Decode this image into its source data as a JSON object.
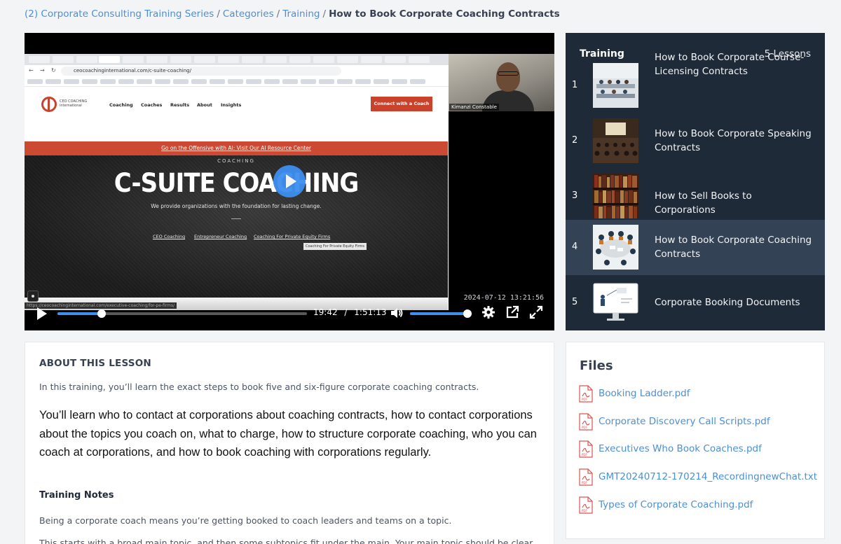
{
  "breadcrumb": {
    "items": [
      "(2) Corporate Consulting Training Series",
      "Categories",
      "Training"
    ],
    "current": "How to Book Corporate Coaching Contracts"
  },
  "video": {
    "browser_url": "ceocoachinginternational.com/c-suite-coaching/",
    "site_logo_text": "CEO COACHING international",
    "site_nav": [
      "Coaching",
      "Coaches",
      "Results",
      "About",
      "Insights"
    ],
    "connect_button": "Connect with a Coach",
    "promo_banner": "Go on the Offensive with AI: Visit Our AI Resource Center",
    "hero_eyebrow": "COACHING",
    "hero_headline": "C-SUITE COACHING",
    "hero_sub": "We provide organizations with the foundation for lasting change.",
    "hero_links": [
      "CEO Coaching",
      "Entrepreneur Coaching",
      "Coaching For Private Equity Firms"
    ],
    "hero_tooltip": "Coaching For Private Equity Firms",
    "webcam_name": "Kimanzi Constable",
    "recording_timestamp": "2024-07-12  13:21:56",
    "status_url": "https://ceocoachinginternational.com/executive-coaching/for-pe-firms/",
    "current_time": "19:42",
    "time_separator": "/",
    "duration": "1:51:13",
    "progress_fraction": 0.177,
    "volume_fraction": 1.0,
    "accent_color": "#3d8ff0"
  },
  "playlist": {
    "title": "Training",
    "count": "5 Lessons",
    "lessons": [
      {
        "num": "1",
        "name": "How to Book Corporate Course-Licensing Contracts",
        "thumb": "classroom"
      },
      {
        "num": "2",
        "name": "How to Book Corporate Speaking Contracts",
        "thumb": "auditorium"
      },
      {
        "num": "3",
        "name": "How to Sell Books to Corporations",
        "thumb": "bookshelf"
      },
      {
        "num": "4",
        "name": "How to Book Corporate Coaching Contracts",
        "thumb": "meeting",
        "active": true
      },
      {
        "num": "5",
        "name": "Corporate Booking Documents",
        "thumb": "monitor"
      }
    ]
  },
  "about": {
    "heading": "ABOUT THIS LESSON",
    "intro": "In this training, you’ll learn the exact steps to book five and six-figure corporate coaching contracts.",
    "big_text": "You’ll learn who to contact at corporations about coaching contracts, how to contact corporations about the topics you coach on, what to charge, how to structure corporate coaching, who you can coach at corporations, and how to book coaching with corporations regularly.",
    "notes_heading": "Training Notes",
    "p1": "Being a corporate coach means you’re getting booked to coach leaders and teams on a topic.",
    "p2": "This starts with a broad main topic, and then some subtopics fit under the main. Your main topic should be clear."
  },
  "files": {
    "title": "Files",
    "items": [
      "Booking Ladder.pdf",
      "Corporate Discovery Call Scripts.pdf",
      "Executives Who Book Coaches.pdf",
      "GMT20240712-170214_RecordingnewChat.txt",
      "Types of Corporate Coaching.pdf"
    ]
  }
}
